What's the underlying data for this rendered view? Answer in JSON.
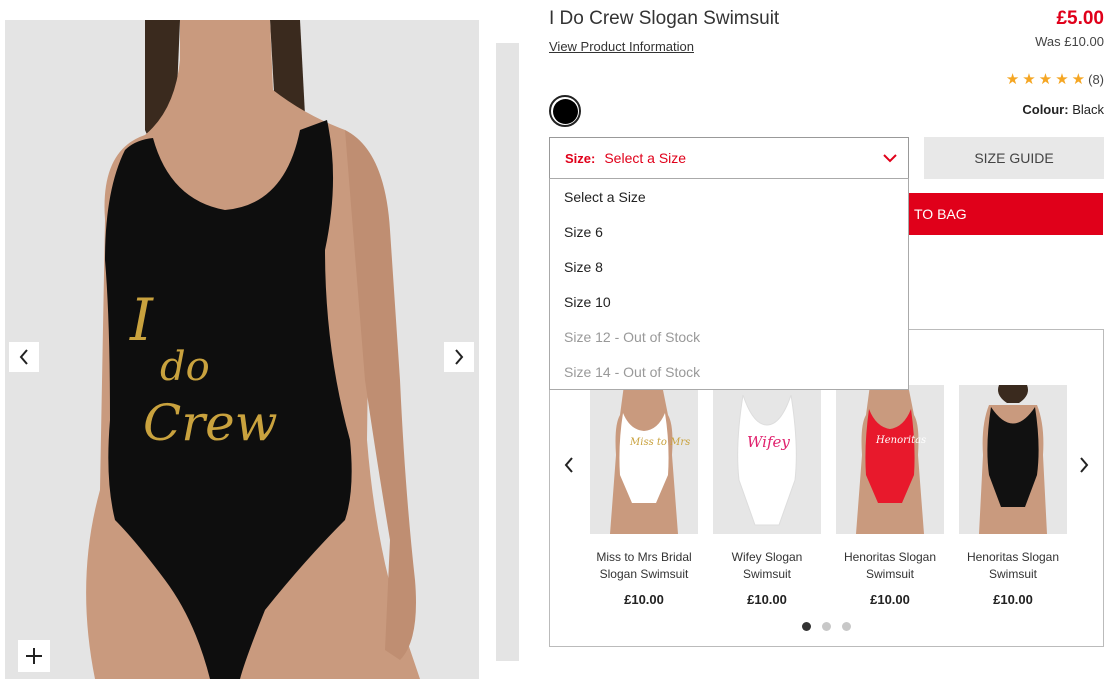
{
  "product": {
    "title": "I Do Crew Slogan Swimsuit",
    "view_info": "View Product Information",
    "price": "£5.00",
    "was": "Was £10.00",
    "rating_count": "(8)",
    "stars": 5,
    "colour_label": "Colour:",
    "colour_value": "Black",
    "swatch_color": "#000000",
    "slogan": "I do Crew"
  },
  "size": {
    "label": "Size:",
    "placeholder": "Select a Size",
    "guide": "SIZE GUIDE",
    "options": [
      {
        "label": "Select a Size",
        "oos": false
      },
      {
        "label": "Size 6",
        "oos": false
      },
      {
        "label": "Size 8",
        "oos": false
      },
      {
        "label": "Size 10",
        "oos": false
      },
      {
        "label": "Size 12 - Out of Stock",
        "oos": true
      },
      {
        "label": "Size 14 - Out of Stock",
        "oos": true
      }
    ]
  },
  "add_to_bag": "ADD TO BAG",
  "add_to_bag_visible": "TO BAG",
  "recommendations": [
    {
      "name": "Miss to Mrs Bridal Slogan Swimsuit",
      "name_l1": "Miss to Mrs Bridal",
      "name_l2": "Slogan Swimsuit",
      "price": "£10.00",
      "suit_color": "#ffffff",
      "slogan": "Miss to Mrs"
    },
    {
      "name": "Wifey Slogan Swimsuit",
      "name_l1": "Wifey Slogan",
      "name_l2": "Swimsuit",
      "price": "£10.00",
      "suit_color": "#ffffff",
      "slogan": "Wifey"
    },
    {
      "name": "Henoritas Slogan Swimsuit",
      "name_l1": "Henoritas Slogan",
      "name_l2": "Swimsuit",
      "price": "£10.00",
      "suit_color": "#e8192c",
      "slogan": "Henoritas"
    },
    {
      "name": "Henoritas Slogan Swimsuit",
      "name_l1": "Henoritas Slogan",
      "name_l2": "Swimsuit",
      "price": "£10.00",
      "suit_color": "#111111",
      "slogan": ""
    }
  ],
  "colors": {
    "accent": "#e0001a",
    "star": "#f5a623"
  }
}
